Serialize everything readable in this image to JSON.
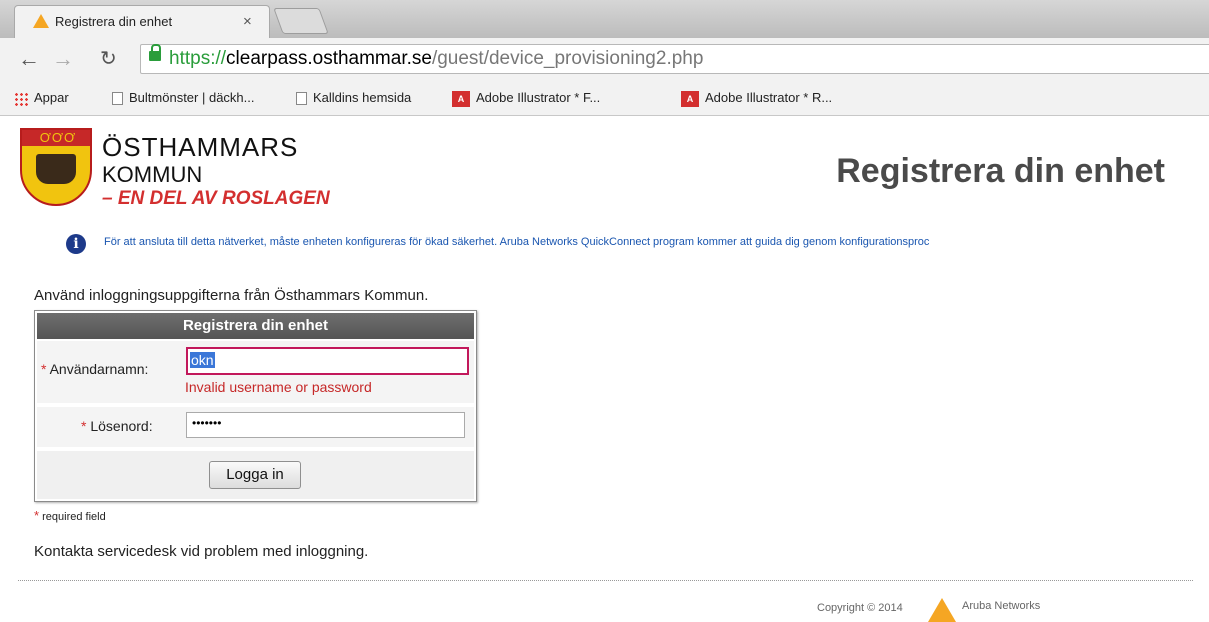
{
  "tab": {
    "title": "Registrera din enhet",
    "close": "×"
  },
  "address_bar": {
    "scheme": "https://",
    "host": "clearpass.osthammar.se",
    "path": "/guest/device_provisioning2.php"
  },
  "bookmarks": [
    {
      "label": "Appar",
      "icon": "apps-grid-icon"
    },
    {
      "label": "Bultmönster | däckh...",
      "icon": "page-icon"
    },
    {
      "label": "Kalldins hemsida",
      "icon": "page-icon"
    },
    {
      "label": "Adobe Illustrator * F...",
      "icon": "adobe-icon"
    },
    {
      "label": "Adobe Illustrator * R...",
      "icon": "adobe-icon"
    }
  ],
  "logo": {
    "shield_text": "ƠƠƠ",
    "line1": "ÖSTHAMMARS",
    "line2": "KOMMUN",
    "line3": "– EN DEL AV ROSLAGEN"
  },
  "page_title": "Registrera din enhet",
  "info_text": "För att ansluta till detta nätverket, måste enheten konfigureras för ökad säkerhet. Aruba Networks QuickConnect program kommer att guida dig genom konfigurationsproc",
  "instruction": "Använd inloggningsuppgifterna från Östhammars Kommun.",
  "form": {
    "header": "Registrera din enhet",
    "username_label": "Användarnamn:",
    "username_value": "okn",
    "error": "Invalid username or password",
    "password_label": "Lösenord:",
    "password_value": "•••••••",
    "submit": "Logga in",
    "required_star": "*"
  },
  "required_note": "required field",
  "contact": "Kontakta servicedesk vid problem med inloggning.",
  "footer": {
    "copyright": "Copyright © 2014",
    "brand": "Aruba Networks"
  },
  "colors": {
    "accent": "#f5a623",
    "error": "#c62828",
    "link": "#1a56b0"
  }
}
